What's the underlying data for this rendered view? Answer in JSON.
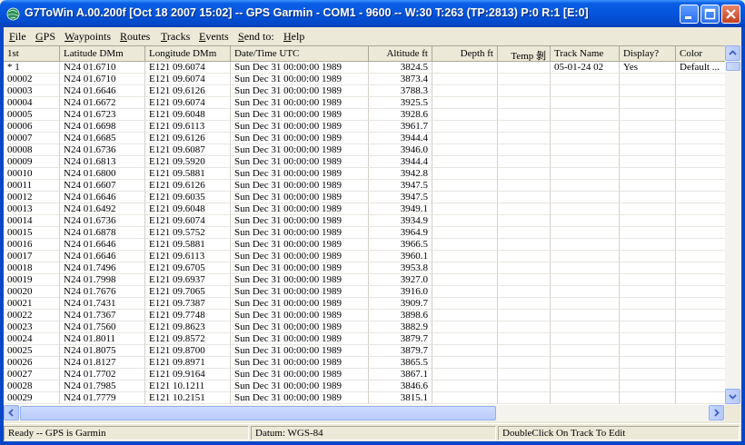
{
  "window": {
    "title": "G7ToWin A.00.200f [Oct 18 2007 15:02] -- GPS Garmin - COM1 - 9600 -- W:30 T:263 (TP:2813) P:0 R:1 [E:0]"
  },
  "menu": [
    {
      "label": "File",
      "key": "F",
      "rest": "ile"
    },
    {
      "label": "GPS",
      "key": "G",
      "rest": "PS"
    },
    {
      "label": "Waypoints",
      "key": "W",
      "rest": "aypoints"
    },
    {
      "label": "Routes",
      "key": "R",
      "rest": "outes"
    },
    {
      "label": "Tracks",
      "key": "T",
      "rest": "racks"
    },
    {
      "label": "Events",
      "key": "E",
      "rest": "vents"
    },
    {
      "label": "Send to:",
      "key": "S",
      "rest": "end to:"
    },
    {
      "label": "Help",
      "key": "H",
      "rest": "elp"
    }
  ],
  "columns": [
    "1st",
    "Latitude DMm",
    "Longitude DMm",
    "Date/Time  UTC",
    "Altitude  ft",
    "Depth  ft",
    "Temp  剝",
    "Track Name",
    "Display?",
    "Color"
  ],
  "rows": [
    [
      "*   1",
      "N24 01.6710",
      "E121 09.6074",
      "Sun Dec 31 00:00:00 1989",
      "3824.5",
      "",
      "",
      "05-01-24 02",
      "Yes",
      "Default ..."
    ],
    [
      "00002",
      "N24 01.6710",
      "E121 09.6074",
      "Sun Dec 31 00:00:00 1989",
      "3873.4",
      "",
      "",
      "",
      "",
      ""
    ],
    [
      "00003",
      "N24 01.6646",
      "E121 09.6126",
      "Sun Dec 31 00:00:00 1989",
      "3788.3",
      "",
      "",
      "",
      "",
      ""
    ],
    [
      "00004",
      "N24 01.6672",
      "E121 09.6074",
      "Sun Dec 31 00:00:00 1989",
      "3925.5",
      "",
      "",
      "",
      "",
      ""
    ],
    [
      "00005",
      "N24 01.6723",
      "E121 09.6048",
      "Sun Dec 31 00:00:00 1989",
      "3928.6",
      "",
      "",
      "",
      "",
      ""
    ],
    [
      "00006",
      "N24 01.6698",
      "E121 09.6113",
      "Sun Dec 31 00:00:00 1989",
      "3961.7",
      "",
      "",
      "",
      "",
      ""
    ],
    [
      "00007",
      "N24 01.6685",
      "E121 09.6126",
      "Sun Dec 31 00:00:00 1989",
      "3944.4",
      "",
      "",
      "",
      "",
      ""
    ],
    [
      "00008",
      "N24 01.6736",
      "E121 09.6087",
      "Sun Dec 31 00:00:00 1989",
      "3946.0",
      "",
      "",
      "",
      "",
      ""
    ],
    [
      "00009",
      "N24 01.6813",
      "E121 09.5920",
      "Sun Dec 31 00:00:00 1989",
      "3944.4",
      "",
      "",
      "",
      "",
      ""
    ],
    [
      "00010",
      "N24 01.6800",
      "E121 09.5881",
      "Sun Dec 31 00:00:00 1989",
      "3942.8",
      "",
      "",
      "",
      "",
      ""
    ],
    [
      "00011",
      "N24 01.6607",
      "E121 09.6126",
      "Sun Dec 31 00:00:00 1989",
      "3947.5",
      "",
      "",
      "",
      "",
      ""
    ],
    [
      "00012",
      "N24 01.6646",
      "E121 09.6035",
      "Sun Dec 31 00:00:00 1989",
      "3947.5",
      "",
      "",
      "",
      "",
      ""
    ],
    [
      "00013",
      "N24 01.6492",
      "E121 09.6048",
      "Sun Dec 31 00:00:00 1989",
      "3949.1",
      "",
      "",
      "",
      "",
      ""
    ],
    [
      "00014",
      "N24 01.6736",
      "E121 09.6074",
      "Sun Dec 31 00:00:00 1989",
      "3934.9",
      "",
      "",
      "",
      "",
      ""
    ],
    [
      "00015",
      "N24 01.6878",
      "E121 09.5752",
      "Sun Dec 31 00:00:00 1989",
      "3964.9",
      "",
      "",
      "",
      "",
      ""
    ],
    [
      "00016",
      "N24 01.6646",
      "E121 09.5881",
      "Sun Dec 31 00:00:00 1989",
      "3966.5",
      "",
      "",
      "",
      "",
      ""
    ],
    [
      "00017",
      "N24 01.6646",
      "E121 09.6113",
      "Sun Dec 31 00:00:00 1989",
      "3960.1",
      "",
      "",
      "",
      "",
      ""
    ],
    [
      "00018",
      "N24 01.7496",
      "E121 09.6705",
      "Sun Dec 31 00:00:00 1989",
      "3953.8",
      "",
      "",
      "",
      "",
      ""
    ],
    [
      "00019",
      "N24 01.7998",
      "E121 09.6937",
      "Sun Dec 31 00:00:00 1989",
      "3927.0",
      "",
      "",
      "",
      "",
      ""
    ],
    [
      "00020",
      "N24 01.7676",
      "E121 09.7065",
      "Sun Dec 31 00:00:00 1989",
      "3916.0",
      "",
      "",
      "",
      "",
      ""
    ],
    [
      "00021",
      "N24 01.7431",
      "E121 09.7387",
      "Sun Dec 31 00:00:00 1989",
      "3909.7",
      "",
      "",
      "",
      "",
      ""
    ],
    [
      "00022",
      "N24 01.7367",
      "E121 09.7748",
      "Sun Dec 31 00:00:00 1989",
      "3898.6",
      "",
      "",
      "",
      "",
      ""
    ],
    [
      "00023",
      "N24 01.7560",
      "E121 09.8623",
      "Sun Dec 31 00:00:00 1989",
      "3882.9",
      "",
      "",
      "",
      "",
      ""
    ],
    [
      "00024",
      "N24 01.8011",
      "E121 09.8572",
      "Sun Dec 31 00:00:00 1989",
      "3879.7",
      "",
      "",
      "",
      "",
      ""
    ],
    [
      "00025",
      "N24 01.8075",
      "E121 09.8700",
      "Sun Dec 31 00:00:00 1989",
      "3879.7",
      "",
      "",
      "",
      "",
      ""
    ],
    [
      "00026",
      "N24 01.8127",
      "E121 09.8971",
      "Sun Dec 31 00:00:00 1989",
      "3865.5",
      "",
      "",
      "",
      "",
      ""
    ],
    [
      "00027",
      "N24 01.7702",
      "E121 09.9164",
      "Sun Dec 31 00:00:00 1989",
      "3867.1",
      "",
      "",
      "",
      "",
      ""
    ],
    [
      "00028",
      "N24 01.7985",
      "E121 10.1211",
      "Sun Dec 31 00:00:00 1989",
      "3846.6",
      "",
      "",
      "",
      "",
      ""
    ],
    [
      "00029",
      "N24 01.7779",
      "E121 10.2151",
      "Sun Dec 31 00:00:00 1989",
      "3815.1",
      "",
      "",
      "",
      "",
      ""
    ]
  ],
  "status": {
    "left": "Ready -- GPS is Garmin",
    "middle": "Datum: WGS-84",
    "right": "DoubleClick On Track To Edit"
  },
  "icons": {
    "app": "globe-icon",
    "minimize": "minimize-icon",
    "maximize": "maximize-icon",
    "close": "close-icon"
  }
}
